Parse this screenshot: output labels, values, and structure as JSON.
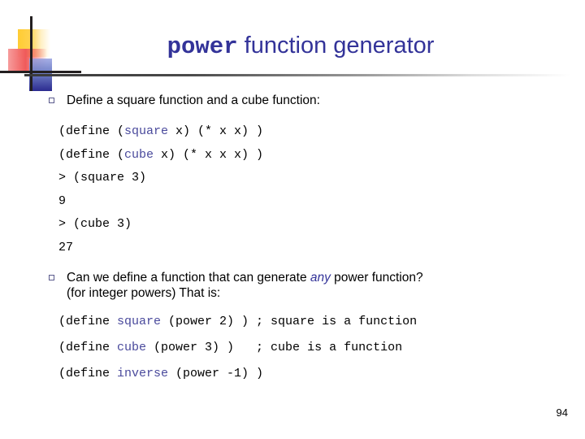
{
  "slide": {
    "title": {
      "mono_part": "power",
      "sans_part": " function generator"
    },
    "page_number": "94",
    "accent_color": "#333399",
    "code_keyword_color": "#4a4a9c",
    "bullet_marker_color": "#5a5a8c"
  },
  "logo": {
    "yellow_square": "#ffcc33",
    "red_square": "#f05a5a",
    "blue_square": "#2b2b8f",
    "cross_lines": "#231f20"
  },
  "bullets": [
    {
      "marker": "hollow-square-bullet",
      "line1_a": "Define a square function and a cube function:"
    },
    {
      "marker": "hollow-square-bullet",
      "line1_a": "Can we define a function that can generate ",
      "line1_em": "any",
      "line1_b": " power function?",
      "line2": "(for integer powers)  That is:"
    }
  ],
  "code_block_1": {
    "line1": {
      "a": "(define (",
      "kw": "square",
      "b": " x) (* x x) )"
    },
    "line2": {
      "a": "(define (",
      "kw": "cube",
      "b": " x) (* x x x) )"
    },
    "line3": "> (square 3)",
    "line4": "9",
    "line5": "> (cube 3)",
    "line6": "27"
  },
  "code_block_2": {
    "line1": {
      "a": "(define ",
      "kw": "square",
      "b": " (power 2) ) ; square is a function"
    },
    "line2": {
      "a": "(define ",
      "kw": "cube",
      "b": " (power 3) )   ; cube is a function"
    },
    "line3": {
      "a": "(define ",
      "kw": "inverse",
      "b": " (power -1) )"
    }
  }
}
